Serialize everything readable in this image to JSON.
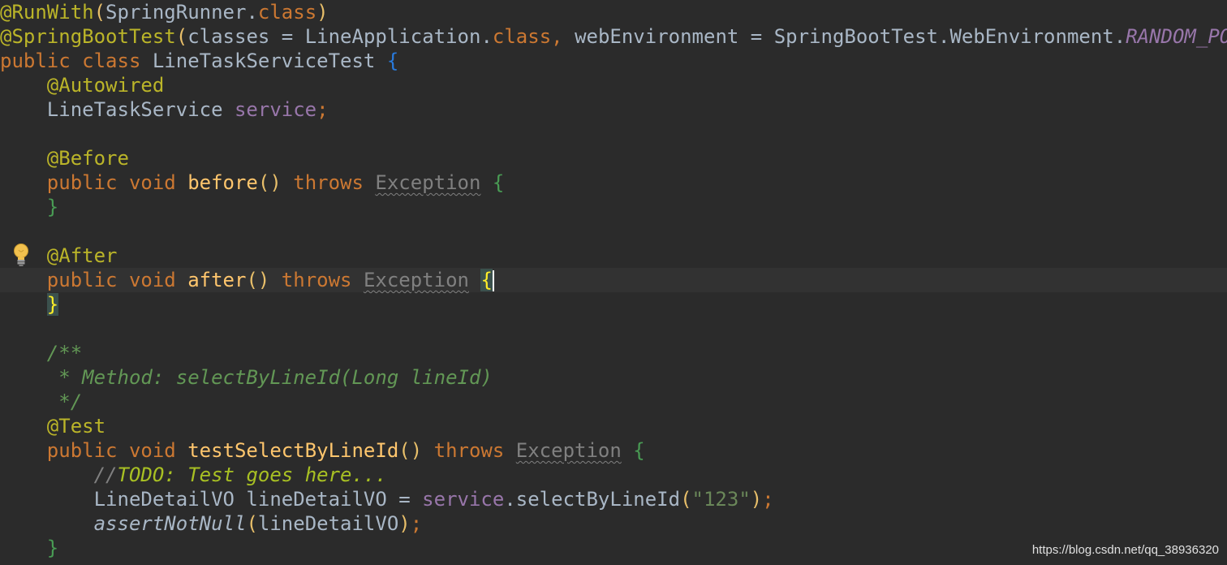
{
  "editor": {
    "language": "java",
    "background": "#2b2b2b",
    "tokens": {
      "l1_ann": "@RunWith",
      "l1_p1": "(",
      "l1_cls": "SpringRunner.",
      "l1_kw": "class",
      "l1_p2": ")",
      "l2_ann": "@SpringBootTest",
      "l2_p1": "(",
      "l2_param": "classes",
      "l2_eq": " = LineApplication.",
      "l2_kw": "class",
      "l2_comma": ", ",
      "l2_param2": "webEnvironment",
      "l2_eq2": " = SpringBootTest.WebEnvironment.",
      "l2_enum": "RANDOM_PORT",
      "l2_p2": ")",
      "l3_kw": "public class ",
      "l3_cls": "LineTaskServiceTest ",
      "l3_brace": "{",
      "l4_ann": "@Autowired",
      "l5_cls": "LineTaskService ",
      "l5_field": "service",
      "l5_semi": ";",
      "l7_ann": "@Before",
      "l8_kw": "public void ",
      "l8_fn": "before",
      "l8_paren": "()",
      "l8_kw2": " throws ",
      "l8_exc": "Exception",
      "l8_brace": " {",
      "l9_brace": "}",
      "l11_ann": "@After",
      "l12_kw": "public void ",
      "l12_fn": "after",
      "l12_paren": "()",
      "l12_kw2": " throws ",
      "l12_exc": "Exception",
      "l12_sp": " ",
      "l12_brace": "{",
      "l13_brace": "}",
      "l15_cmt": "/**",
      "l16_cmt": " * Method: selectByLineId(Long lineId)",
      "l17_cmt": " */",
      "l18_ann": "@Test",
      "l19_kw": "public void ",
      "l19_fn": "testSelectByLineId",
      "l19_paren": "()",
      "l19_kw2": " throws ",
      "l19_exc": "Exception",
      "l19_brace": " {",
      "l20_slash": "//",
      "l20_todo": "TODO: Test goes here...",
      "l21_cls": "LineDetailVO lineDetailVO = ",
      "l21_field": "service",
      "l21_call": ".selectByLineId",
      "l21_p1": "(",
      "l21_str": "\"123\"",
      "l21_p2": ")",
      "l21_semi": ";",
      "l22_call": "assertNotNull",
      "l22_p1": "(",
      "l22_arg": "lineDetailVO",
      "l22_p2": ")",
      "l22_semi": ";",
      "l23_brace": "}"
    }
  },
  "icons": {
    "intention_bulb": "lightbulb-icon"
  },
  "colors": {
    "annotation": "#bbb529",
    "keyword": "#cc7832",
    "method": "#ffc66d",
    "field": "#9876aa",
    "string": "#6a8759",
    "comment": "#629755",
    "brace": "#499c54"
  },
  "watermark": "https://blog.csdn.net/qq_38936320"
}
